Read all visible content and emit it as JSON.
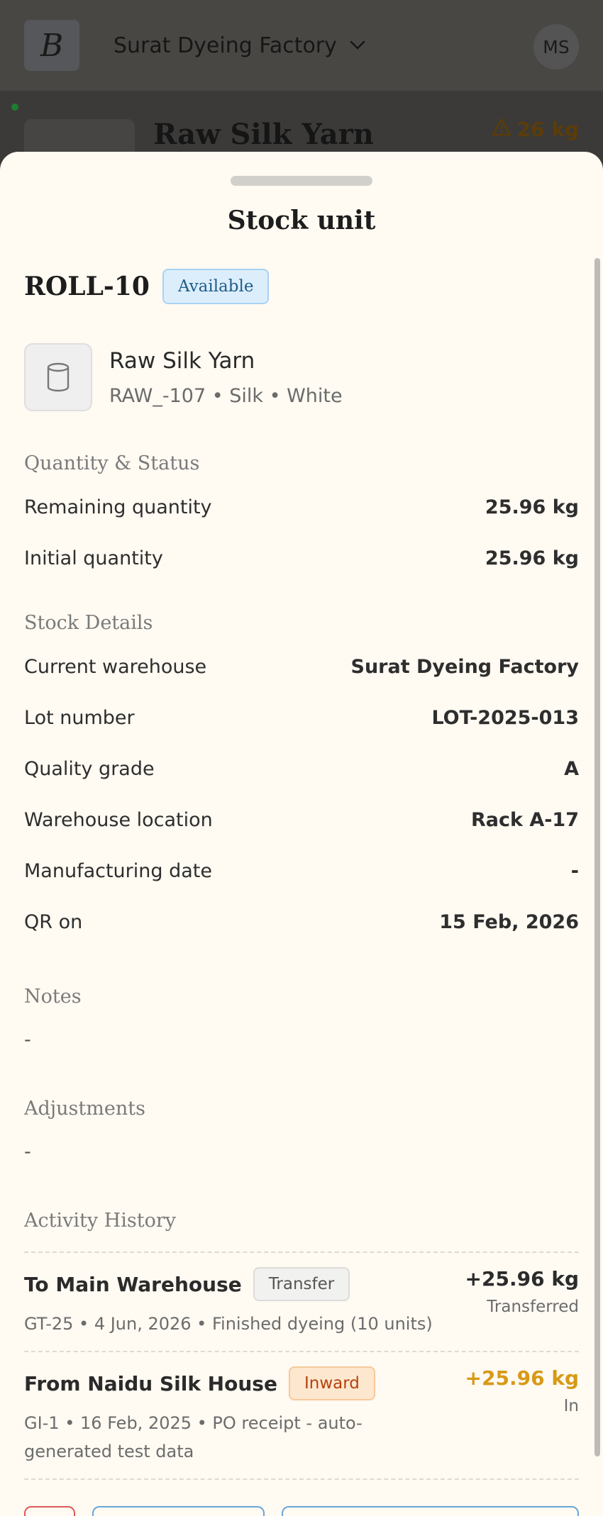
{
  "header": {
    "logo_text": "B",
    "warehouse": "Surat Dyeing Factory",
    "avatar": "MS"
  },
  "background": {
    "title": "Raw Silk Yarn",
    "warning": "26 kg"
  },
  "sheet": {
    "title": "Stock unit",
    "unit_id": "ROLL-10",
    "status": "Available",
    "product": {
      "name": "Raw Silk Yarn",
      "meta": "RAW_-107 • Silk • White",
      "icon": "cylinder-icon"
    },
    "quantity_section": {
      "heading": "Quantity & Status",
      "rows": [
        {
          "label": "Remaining quantity",
          "value": "25.96 kg"
        },
        {
          "label": "Initial quantity",
          "value": "25.96 kg"
        }
      ]
    },
    "details_section": {
      "heading": "Stock Details",
      "rows": [
        {
          "label": "Current warehouse",
          "value": "Surat Dyeing Factory"
        },
        {
          "label": "Lot number",
          "value": "LOT-2025-013"
        },
        {
          "label": "Quality grade",
          "value": "A"
        },
        {
          "label": "Warehouse location",
          "value": "Rack A-17"
        },
        {
          "label": "Manufacturing date",
          "value": "-"
        },
        {
          "label": "QR on",
          "value": "15 Feb, 2026"
        }
      ]
    },
    "notes": {
      "heading": "Notes",
      "value": "-"
    },
    "adjustments": {
      "heading": "Adjustments",
      "value": "-"
    },
    "activity": {
      "heading": "Activity History",
      "items": [
        {
          "title": "To Main Warehouse",
          "tag": "Transfer",
          "sub": "GT-25 • 4 Jun, 2026 • Finished dyeing (10 units)",
          "amount": "+25.96 kg",
          "note": "Transferred"
        },
        {
          "title": "From Naidu Silk House",
          "tag": "Inward",
          "sub": "GI-1 • 16 Feb, 2025 • PO receipt - auto-generated test data",
          "amount": "+25.96 kg",
          "note": "In"
        }
      ]
    }
  }
}
